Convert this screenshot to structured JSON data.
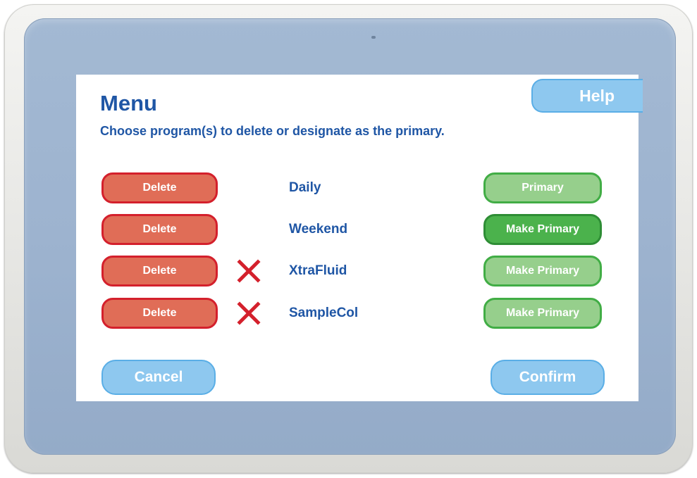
{
  "screen": {
    "title": "Menu",
    "subtitle": "Choose program(s) to delete or designate as the primary.",
    "help_label": "Help"
  },
  "programs": [
    {
      "name": "Daily",
      "delete_label": "Delete",
      "primary_label": "Primary",
      "marked_for_delete": false,
      "is_primary": true
    },
    {
      "name": "Weekend",
      "delete_label": "Delete",
      "primary_label": "Make Primary",
      "marked_for_delete": false,
      "is_primary": false
    },
    {
      "name": "XtraFluid",
      "delete_label": "Delete",
      "primary_label": "Make Primary",
      "marked_for_delete": true,
      "is_primary": false
    },
    {
      "name": "SampleCol",
      "delete_label": "Delete",
      "primary_label": "Make Primary",
      "marked_for_delete": true,
      "is_primary": false
    }
  ],
  "actions": {
    "cancel_label": "Cancel",
    "confirm_label": "Confirm"
  },
  "icons": {
    "delete_mark": "x-mark-icon"
  },
  "colors": {
    "text_blue": "#1f56a5",
    "delete_fill": "#e06d57",
    "delete_border": "#d4202c",
    "primary_light": "#96cf8c",
    "primary_dark": "#4bb24c",
    "blue_button": "#8ec8ef",
    "x_mark": "#d4202c"
  }
}
